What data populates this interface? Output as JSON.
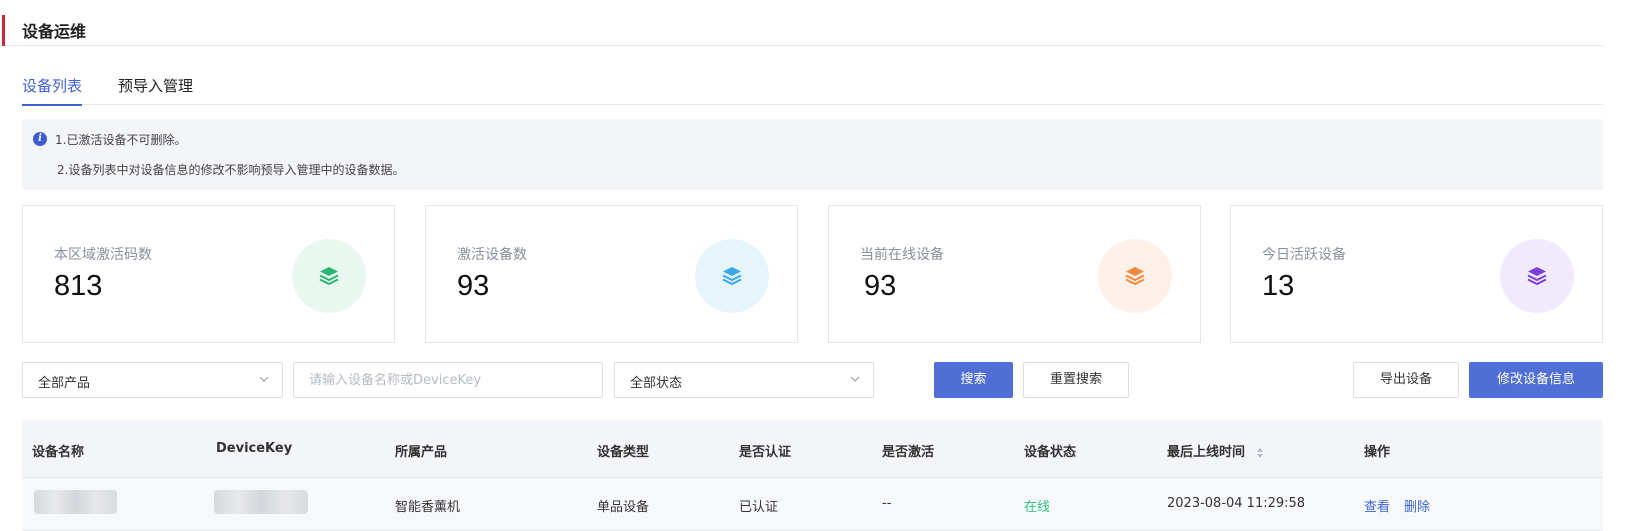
{
  "page": {
    "title": "设备运维"
  },
  "tabs": [
    {
      "label": "设备列表",
      "active": true
    },
    {
      "label": "预导入管理",
      "active": false
    }
  ],
  "notice": {
    "icon": "info-icon",
    "line1": "1.已激活设备不可删除。",
    "line2": "2.设备列表中对设备信息的修改不影响预导入管理中的设备数据。"
  },
  "stats": [
    {
      "label": "本区域激活码数",
      "value": "813",
      "icon": "layers-icon",
      "color": "#2bb673",
      "bg": "#e8f7ef"
    },
    {
      "label": "激活设备数",
      "value": "93",
      "icon": "layers-icon",
      "color": "#3aa8e8",
      "bg": "#e6f5fc"
    },
    {
      "label": "当前在线设备",
      "value": "93",
      "icon": "layers-icon",
      "color": "#f08a3c",
      "bg": "#fdf0e8"
    },
    {
      "label": "今日活跃设备",
      "value": "13",
      "icon": "layers-icon",
      "color": "#7a3fd6",
      "bg": "#f1eafc"
    }
  ],
  "filters": {
    "product_select": "全部产品",
    "search_placeholder": "请输入设备名称或DeviceKey",
    "status_select": "全部状态",
    "search_btn": "搜索",
    "reset_btn": "重置搜索",
    "export_btn": "导出设备",
    "edit_btn": "修改设备信息"
  },
  "table": {
    "columns": [
      "设备名称",
      "DeviceKey",
      "所属产品",
      "设备类型",
      "是否认证",
      "是否激活",
      "设备状态",
      "最后上线时间",
      "操作"
    ],
    "rows": [
      {
        "product": "智能香薰机",
        "type": "单品设备",
        "certified": "已认证",
        "activated": "--",
        "status": "在线",
        "last_online": "2023-08-04 11:29:58",
        "action_view": "查看",
        "action_delete": "删除"
      }
    ]
  },
  "colors": {
    "accent": "#3f63d2",
    "primary_btn": "#4f6fd6",
    "online": "#31c27c",
    "header_bar": "#d0263a"
  }
}
